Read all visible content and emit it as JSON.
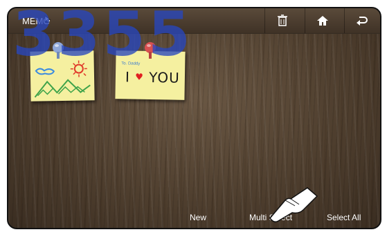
{
  "watermark": "3355",
  "header": {
    "title": "MEMO",
    "buttons": [
      {
        "icon": "trash-can-icon"
      },
      {
        "icon": "home-icon"
      },
      {
        "icon": "back-arrow-icon"
      }
    ]
  },
  "memos": [
    {
      "content": "drawing of sun, clouds and mountains",
      "pin_color": "#8fa7d8"
    },
    {
      "small_text": "To. Daddy",
      "main_text_left": "I",
      "heart": "♥",
      "main_text_right": "YOU",
      "pin_color": "#d85050"
    }
  ],
  "footer": {
    "new_label": "New",
    "multi_select_label": "Multi Select",
    "select_all_label": "Select All"
  },
  "colors": {
    "watermark": "#2846be",
    "note": "#f5f0a0",
    "wood": "#5a4836"
  }
}
